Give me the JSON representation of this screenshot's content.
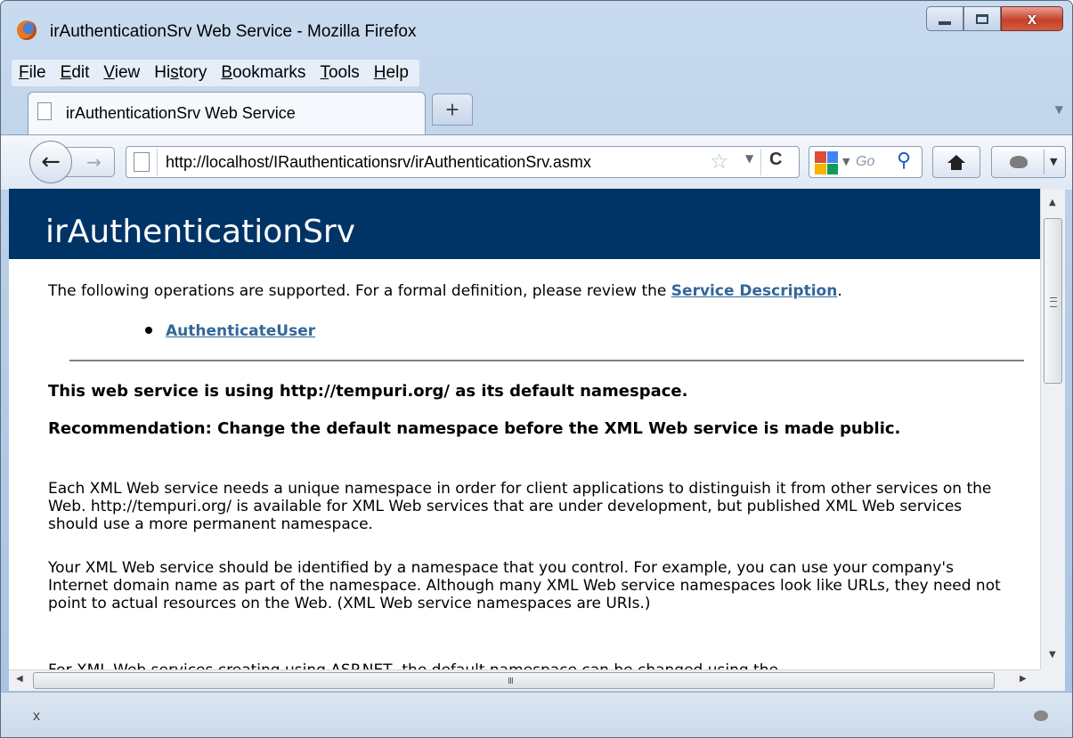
{
  "window": {
    "title": "irAuthenticationSrv Web Service - Mozilla Firefox",
    "close_glyph": "x"
  },
  "menu": [
    {
      "pre": "",
      "u": "F",
      "post": "ile"
    },
    {
      "pre": "",
      "u": "E",
      "post": "dit"
    },
    {
      "pre": "",
      "u": "V",
      "post": "iew"
    },
    {
      "pre": "Hi",
      "u": "s",
      "post": "tory"
    },
    {
      "pre": "",
      "u": "B",
      "post": "ookmarks"
    },
    {
      "pre": "",
      "u": "T",
      "post": "ools"
    },
    {
      "pre": "",
      "u": "H",
      "post": "elp"
    }
  ],
  "tab": {
    "label": "irAuthenticationSrv Web Service",
    "new_tab_glyph": "+"
  },
  "nav": {
    "back_glyph": "←",
    "forward_glyph": "→",
    "url": "http://localhost/IRauthenticationsrv/irAuthenticationSrv.asmx",
    "star_glyph": "☆",
    "reload_glyph": "C",
    "search_placeholder": "Go",
    "search_glyph": "⚲"
  },
  "page": {
    "heading": "irAuthenticationSrv",
    "intro_text": "The following operations are supported. For a formal definition, please review the ",
    "intro_link": "Service Description",
    "intro_end": ".",
    "operations": [
      "AuthenticateUser"
    ],
    "namespace_heading": "This web service is using http://tempuri.org/ as its default namespace.",
    "recommendation_heading": "Recommendation: Change the default namespace before the XML Web service is made public.",
    "paragraph1": "Each XML Web service needs a unique namespace in order for client applications to distinguish it from other services on the Web. http://tempuri.org/ is available for XML Web services that are under development, but published XML Web services should use a more permanent namespace.",
    "paragraph2": "Your XML Web service should be identified by a namespace that you control. For example, you can use your company's Internet domain name as part of the namespace. Although many XML Web service namespaces look like URLs, they need not point to actual resources on the Web. (XML Web service namespaces are URIs.)",
    "cutoff_text": "For XML Web services creating using ASP.NET, the default namespace can be changed using the"
  },
  "scrollbar": {
    "grip_glyph": "III"
  },
  "status": {
    "close_glyph": "x"
  },
  "colors": {
    "heading_bg": "#003366",
    "link": "#336699"
  }
}
